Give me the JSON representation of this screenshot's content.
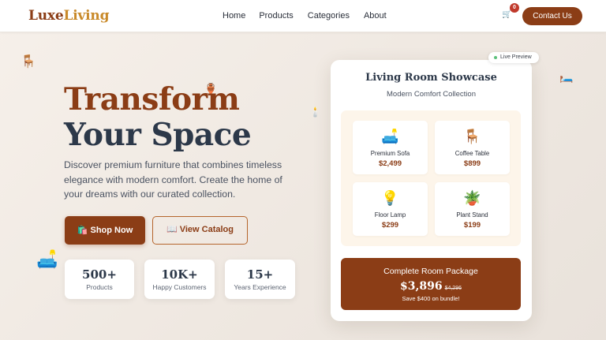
{
  "brand": {
    "part1": "Luxe",
    "part2": "Living"
  },
  "nav": [
    "Home",
    "Products",
    "Categories",
    "About"
  ],
  "cart": {
    "icon": "🛒",
    "count": "0"
  },
  "contact_label": "Contact Us",
  "hero": {
    "title_line1": "Transform",
    "title_line2": "Your Space",
    "description": "Discover premium furniture that combines timeless elegance with modern comfort. Create the home of your dreams with our curated collection.",
    "shop_label": "🛍️ Shop Now",
    "catalog_label": "📖 View Catalog"
  },
  "stats": [
    {
      "value": "500+",
      "label": "Products"
    },
    {
      "value": "10K+",
      "label": "Happy Customers"
    },
    {
      "value": "15+",
      "label": "Years Experience"
    }
  ],
  "decor": {
    "chair": "🪑",
    "lamp_small": "🕯️",
    "bed": "🛏️",
    "sofa": "🛋️",
    "pot": "🏺"
  },
  "showcase": {
    "badge": "Live Preview",
    "title": "Living Room Showcase",
    "subtitle": "Modern Comfort Collection",
    "items": [
      {
        "icon": "🛋️",
        "name": "Premium Sofa",
        "price": "$2,499"
      },
      {
        "icon": "🪑",
        "name": "Coffee Table",
        "price": "$899"
      },
      {
        "icon": "💡",
        "name": "Floor Lamp",
        "price": "$299"
      },
      {
        "icon": "🪴",
        "name": "Plant Stand",
        "price": "$199"
      }
    ],
    "package": {
      "title": "Complete Room Package",
      "price": "$3,896",
      "old_price": "$4,296",
      "savings": "Save $400 on bundle!"
    }
  },
  "colors": {
    "brand": "#8b3d16",
    "accent": "#c98a2a",
    "text": "#2c3849"
  }
}
